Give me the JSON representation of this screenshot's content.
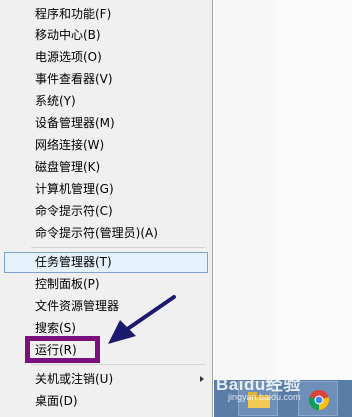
{
  "context_menu": {
    "items": [
      {
        "label": "程序和功能(F)"
      },
      {
        "label": "移动中心(B)"
      },
      {
        "label": "电源选项(O)"
      },
      {
        "label": "事件查看器(V)"
      },
      {
        "label": "系统(Y)"
      },
      {
        "label": "设备管理器(M)"
      },
      {
        "label": "网络连接(W)"
      },
      {
        "label": "磁盘管理(K)"
      },
      {
        "label": "计算机管理(G)"
      },
      {
        "label": "命令提示符(C)"
      },
      {
        "label": "命令提示符(管理员)(A)"
      },
      {
        "label": "任务管理器(T)",
        "highlighted": true
      },
      {
        "label": "控制面板(P)"
      },
      {
        "label": "文件资源管理器"
      },
      {
        "label": "搜索(S)"
      },
      {
        "label": "运行(R)",
        "annotated": true
      },
      {
        "label": "关机或注销(U)",
        "has_submenu": true
      },
      {
        "label": "桌面(D)"
      }
    ]
  },
  "watermark": {
    "brand": "Baidu经验",
    "url": "jingyan.baidu.com"
  },
  "colors": {
    "menu_bg": "#f0f0f0",
    "highlight_bg": "#e5f1fb",
    "highlight_border": "#7da2ce",
    "annotation": "#7b0f7b",
    "arrow": "#1c1a6e",
    "taskbar": "#5a7da8"
  },
  "taskbar": {
    "icons": [
      "folder-icon",
      "chrome-icon"
    ]
  }
}
